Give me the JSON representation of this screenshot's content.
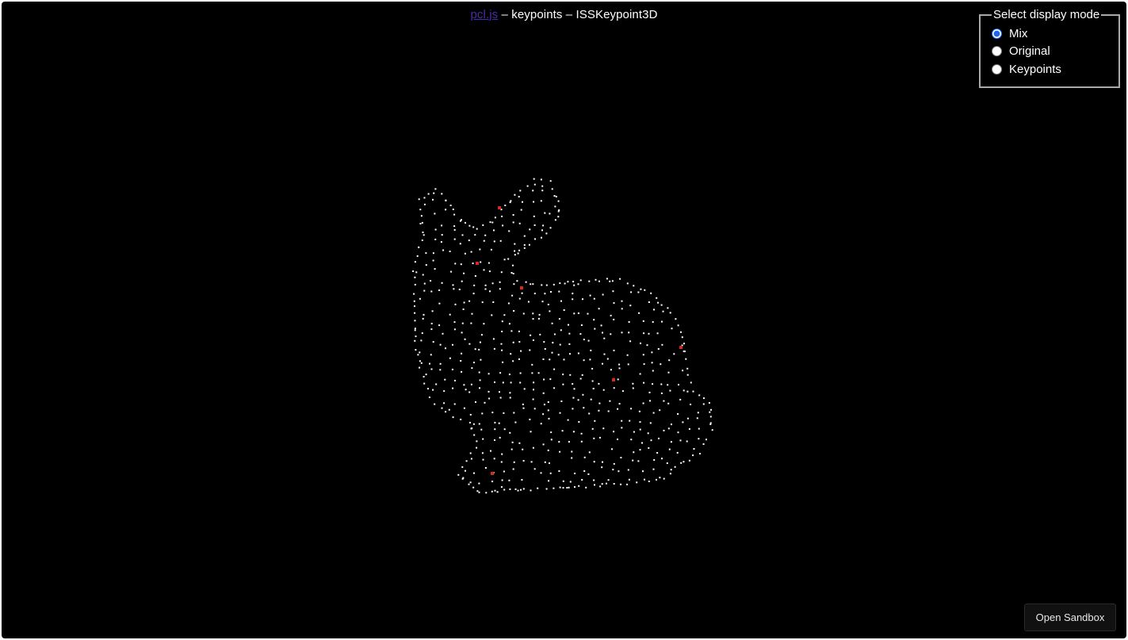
{
  "title": {
    "link_text": "pcl.js",
    "rest_text": " – keypoints – ISSKeypoint3D"
  },
  "display_mode": {
    "legend": "Select display mode",
    "options": [
      {
        "label": "Mix",
        "checked": true
      },
      {
        "label": "Original",
        "checked": false
      },
      {
        "label": "Keypoints",
        "checked": false
      }
    ]
  },
  "sandbox_button": {
    "label": "Open Sandbox"
  },
  "colors": {
    "background": "#000000",
    "original_point": "#ffffff",
    "keypoint": "#d42a1f",
    "link": "#4b2aa8",
    "radio_accent": "#1d64f2"
  }
}
